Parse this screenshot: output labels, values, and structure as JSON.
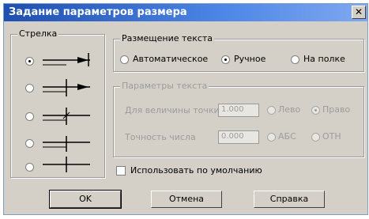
{
  "window": {
    "title": "Задание параметров размера",
    "close_glyph": "✕"
  },
  "arrows_group": {
    "legend": "Стрелка",
    "options": [
      {
        "icon": "arrow-closed-filled",
        "selected": true
      },
      {
        "icon": "arrow-open-filled",
        "selected": false
      },
      {
        "icon": "arrow-tick-through",
        "selected": false
      },
      {
        "icon": "arrow-tick-short",
        "selected": false
      },
      {
        "icon": "arrow-tick-none",
        "selected": false
      }
    ]
  },
  "text_placement": {
    "legend": "Размещение текста",
    "options": [
      {
        "label": "Автоматическое",
        "selected": false
      },
      {
        "label": "Ручное",
        "selected": true
      },
      {
        "label": "На полке",
        "selected": false
      }
    ]
  },
  "text_params": {
    "legend": "Параметры текста",
    "row1": {
      "label": "Для величины точки",
      "value": "1.000",
      "opt_a": "Лево",
      "opt_b": "Право",
      "opt_b_selected": true
    },
    "row2": {
      "label": "Точность числа",
      "value": "0.000",
      "opt_a": "АБС",
      "opt_b": "ОТН",
      "opt_a_selected": false
    }
  },
  "default_checkbox": {
    "label": "Использовать по умолчанию",
    "checked": false
  },
  "buttons": {
    "ok": "OK",
    "cancel": "Отмена",
    "help": "Справка"
  }
}
